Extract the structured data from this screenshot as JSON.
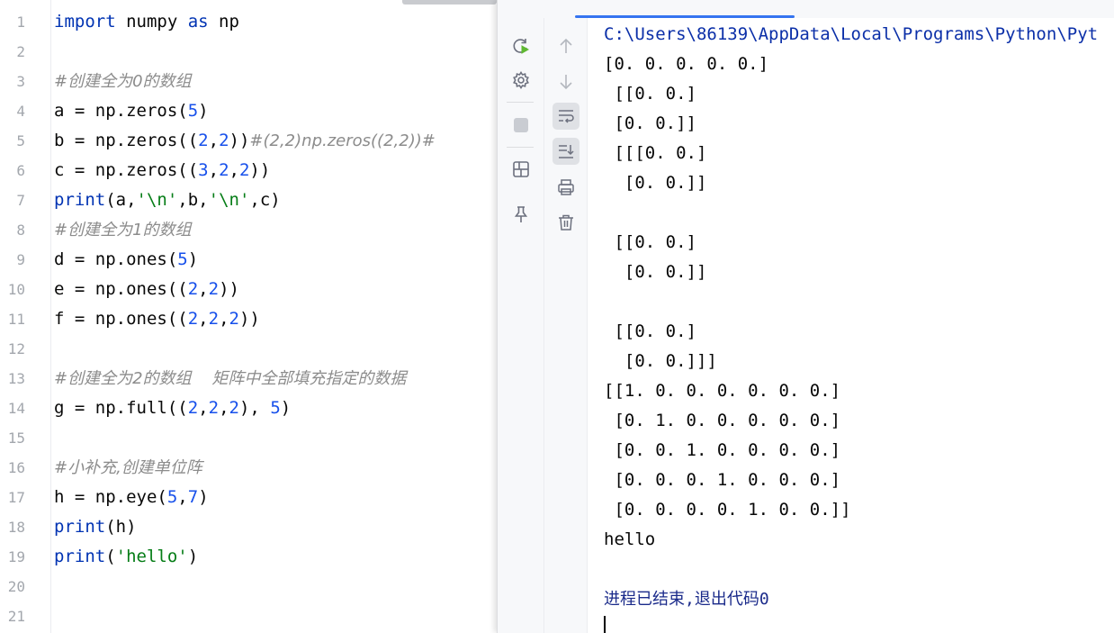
{
  "editor": {
    "line_numbers": [
      "1",
      "2",
      "3",
      "4",
      "5",
      "6",
      "7",
      "8",
      "9",
      "10",
      "11",
      "12",
      "13",
      "14",
      "15",
      "16",
      "17",
      "18",
      "19",
      "20",
      "21"
    ],
    "lines": [
      [
        {
          "t": "kw",
          "v": "import"
        },
        {
          "t": "ident",
          "v": " numpy "
        },
        {
          "t": "kw",
          "v": "as"
        },
        {
          "t": "ident",
          "v": " np"
        }
      ],
      [],
      [
        {
          "t": "cm",
          "v": "#创建全为0的数组"
        }
      ],
      [
        {
          "t": "ident",
          "v": "a = np.zeros("
        },
        {
          "t": "num",
          "v": "5"
        },
        {
          "t": "ident",
          "v": ")"
        }
      ],
      [
        {
          "t": "ident",
          "v": "b = np.zeros(("
        },
        {
          "t": "num",
          "v": "2"
        },
        {
          "t": "ident",
          "v": ","
        },
        {
          "t": "num",
          "v": "2"
        },
        {
          "t": "ident",
          "v": "))"
        },
        {
          "t": "cm",
          "v": "#(2,2)np.zeros((2,2))#"
        }
      ],
      [
        {
          "t": "ident",
          "v": "c = np.zeros(("
        },
        {
          "t": "num",
          "v": "3"
        },
        {
          "t": "ident",
          "v": ","
        },
        {
          "t": "num",
          "v": "2"
        },
        {
          "t": "ident",
          "v": ","
        },
        {
          "t": "num",
          "v": "2"
        },
        {
          "t": "ident",
          "v": "))"
        }
      ],
      [
        {
          "t": "kw",
          "v": "print"
        },
        {
          "t": "ident",
          "v": "(a,"
        },
        {
          "t": "str",
          "v": "'\\n'"
        },
        {
          "t": "ident",
          "v": ",b,"
        },
        {
          "t": "str",
          "v": "'\\n'"
        },
        {
          "t": "ident",
          "v": ",c)"
        }
      ],
      [
        {
          "t": "cm",
          "v": "#创建全为1的数组"
        }
      ],
      [
        {
          "t": "ident",
          "v": "d = np.ones("
        },
        {
          "t": "num",
          "v": "5"
        },
        {
          "t": "ident",
          "v": ")"
        }
      ],
      [
        {
          "t": "ident",
          "v": "e = np.ones(("
        },
        {
          "t": "num",
          "v": "2"
        },
        {
          "t": "ident",
          "v": ","
        },
        {
          "t": "num",
          "v": "2"
        },
        {
          "t": "ident",
          "v": "))"
        }
      ],
      [
        {
          "t": "ident",
          "v": "f = np.ones(("
        },
        {
          "t": "num",
          "v": "2"
        },
        {
          "t": "ident",
          "v": ","
        },
        {
          "t": "num",
          "v": "2"
        },
        {
          "t": "ident",
          "v": ","
        },
        {
          "t": "num",
          "v": "2"
        },
        {
          "t": "ident",
          "v": "))"
        }
      ],
      [],
      [
        {
          "t": "cm",
          "v": "#创建全为2的数组    矩阵中全部填充指定的数据"
        }
      ],
      [
        {
          "t": "ident",
          "v": "g = np.full(("
        },
        {
          "t": "num",
          "v": "2"
        },
        {
          "t": "ident",
          "v": ","
        },
        {
          "t": "num",
          "v": "2"
        },
        {
          "t": "ident",
          "v": ","
        },
        {
          "t": "num",
          "v": "2"
        },
        {
          "t": "ident",
          "v": "), "
        },
        {
          "t": "num",
          "v": "5"
        },
        {
          "t": "ident",
          "v": ")"
        }
      ],
      [],
      [
        {
          "t": "cm",
          "v": "#小补充,创建单位阵"
        }
      ],
      [
        {
          "t": "ident",
          "v": "h = np.eye("
        },
        {
          "t": "num",
          "v": "5"
        },
        {
          "t": "ident",
          "v": ","
        },
        {
          "t": "num",
          "v": "7"
        },
        {
          "t": "ident",
          "v": ")"
        }
      ],
      [
        {
          "t": "kw",
          "v": "print"
        },
        {
          "t": "ident",
          "v": "(h)"
        }
      ],
      [
        {
          "t": "kw",
          "v": "print"
        },
        {
          "t": "ident",
          "v": "("
        },
        {
          "t": "str",
          "v": "'hello'"
        },
        {
          "t": "ident",
          "v": ")"
        }
      ],
      [],
      []
    ]
  },
  "run": {
    "output_lines": [
      "C:\\Users\\86139\\AppData\\Local\\Programs\\Python\\Pyt",
      "[0. 0. 0. 0. 0.]",
      " [[0. 0.]",
      " [0. 0.]]",
      " [[[0. 0.]",
      "  [0. 0.]]",
      "",
      " [[0. 0.]",
      "  [0. 0.]]",
      "",
      " [[0. 0.]",
      "  [0. 0.]]]",
      "[[1. 0. 0. 0. 0. 0. 0.]",
      " [0. 1. 0. 0. 0. 0. 0.]",
      " [0. 0. 1. 0. 0. 0. 0.]",
      " [0. 0. 0. 1. 0. 0. 0.]",
      " [0. 0. 0. 0. 1. 0. 0.]]",
      "hello",
      "",
      "进程已结束,退出代码0"
    ]
  },
  "icons": {
    "rerun": "rerun-icon",
    "settings": "gear-icon",
    "stop": "stop-icon",
    "layout": "layout-icon",
    "pin": "pin-icon",
    "up": "arrow-up-icon",
    "down": "arrow-down-icon",
    "softwrap": "soft-wrap-icon",
    "scroll_end": "scroll-to-end-icon",
    "print": "print-icon",
    "clear": "trash-icon"
  },
  "colors": {
    "keyword": "#0033b3",
    "number": "#1750eb",
    "string": "#067d17",
    "comment": "#8c8c8c",
    "accent": "#3574f0"
  }
}
